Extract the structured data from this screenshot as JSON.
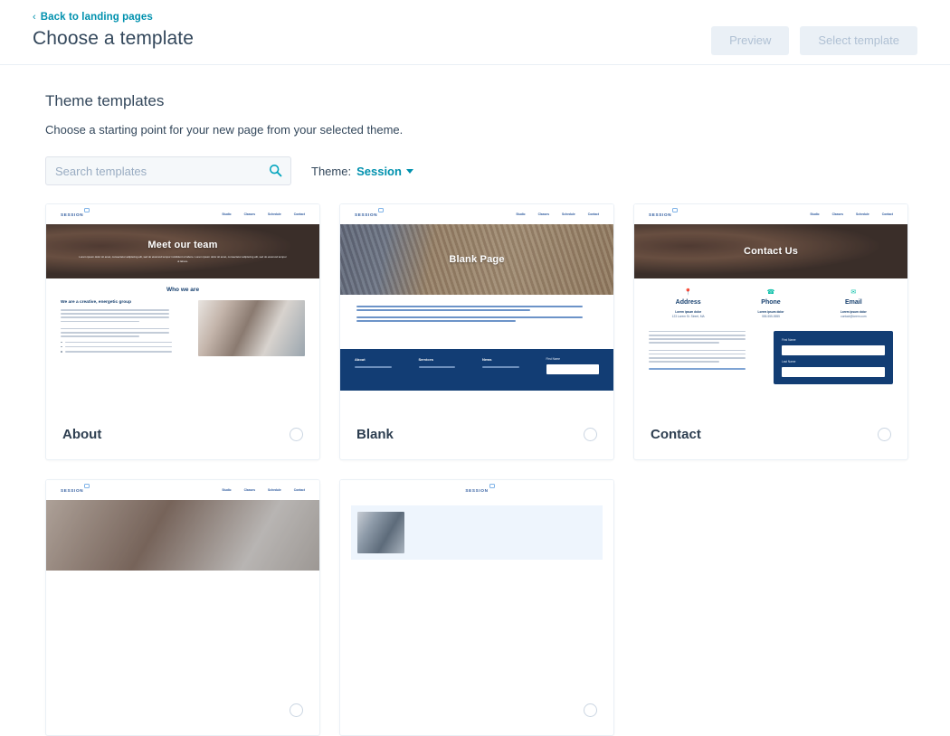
{
  "header": {
    "back_link": "Back to landing pages",
    "back_chevron": "chevron-left-icon",
    "title": "Choose a template",
    "preview_button": "Preview",
    "select_button": "Select template"
  },
  "main": {
    "section_title": "Theme templates",
    "section_subtitle": "Choose a starting point for your new page from your selected theme.",
    "search_placeholder": "Search templates",
    "search_value": "",
    "search_icon": "search-icon",
    "theme_label": "Theme:",
    "theme_value": "Session",
    "theme_caret": "caret-down-icon"
  },
  "colors": {
    "link": "#0091ae",
    "text": "#33475b",
    "navy": "#123d74",
    "teal": "#00bda5",
    "border": "#eaf0f6",
    "disabled_bg": "#eaf0f6",
    "disabled_text": "#b0c1d4"
  },
  "preview_common": {
    "logo": "SESSION",
    "nav": [
      "Studio",
      "Classes",
      "Schedule",
      "Contact"
    ]
  },
  "templates": [
    {
      "name": "About",
      "selected": false,
      "hero_title": "Meet our team",
      "hero_sub": "Lorem ipsum dolor sit amet, consectetur adipiscing elit, sed do eiusmod tempor incididunt ut labore. Lorem ipsum dolor sit amet, consectetur adipiscing elit, sed do eiusmod tempor ut labore.",
      "section_title": "Who we are",
      "sub_heading": "We are a creative, energetic group"
    },
    {
      "name": "Blank",
      "selected": false,
      "hero_title": "Blank Page",
      "footer_columns": [
        "About",
        "Services",
        "News"
      ],
      "footer_form_label": "First Name"
    },
    {
      "name": "Contact",
      "selected": false,
      "hero_title": "Contact Us",
      "columns": [
        {
          "icon": "location-pin-icon",
          "title": "Address",
          "line1": "Lorem ipsum dolor",
          "line2": "123 Lorem St. Street, MA"
        },
        {
          "icon": "phone-icon",
          "title": "Phone",
          "line1": "Lorem ipsum dolor",
          "line2": "555-555-5555"
        },
        {
          "icon": "envelope-icon",
          "title": "Email",
          "line1": "Lorem ipsum dolor",
          "line2": "contact@lorem.com"
        }
      ],
      "form_fields": [
        "First Name",
        "Last Name"
      ]
    },
    {
      "name": "",
      "selected": false,
      "hero_title": ""
    },
    {
      "name": "",
      "selected": false,
      "hero_title": ""
    }
  ]
}
